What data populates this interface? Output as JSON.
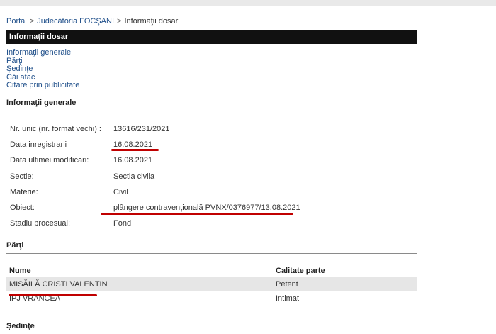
{
  "breadcrumb": {
    "portal": "Portal",
    "court": "Judecătoria FOCŞANI",
    "current": "Informaţii dosar",
    "separator": ">"
  },
  "title": "Informaţii dosar",
  "nav": [
    "Informaţii generale",
    "Părţi",
    "Şedinţe",
    "Căi atac",
    "Citare prin publicitate"
  ],
  "general": {
    "heading": "Informaţii generale",
    "rows": [
      {
        "label": "Nr. unic (nr. format vechi) :",
        "value": "13616/231/2021"
      },
      {
        "label": "Data inregistrarii",
        "value": "16.08.2021"
      },
      {
        "label": "Data ultimei modificari:",
        "value": "16.08.2021"
      },
      {
        "label": "Sectie:",
        "value": "Sectia civila"
      },
      {
        "label": "Materie:",
        "value": "Civil"
      },
      {
        "label": "Obiect:",
        "value": "plângere contravenţională PVNX/0376977/13.08.2021"
      },
      {
        "label": "Stadiu procesual:",
        "value": "Fond"
      }
    ]
  },
  "parti": {
    "heading": "Părţi",
    "columns": [
      "Nume",
      "Calitate parte"
    ],
    "rows": [
      {
        "nume": "MISĂILĂ CRISTI VALENTIN",
        "calitate": "Petent"
      },
      {
        "nume": "IPJ VRANCEA",
        "calitate": "Intimat"
      }
    ]
  },
  "sedinte": {
    "heading": "Şedinţe"
  },
  "colors": {
    "title_bar": "#111111",
    "link": "#1f4f8a",
    "annotation": "#c00000",
    "alt_row": "#e6e6e6"
  }
}
